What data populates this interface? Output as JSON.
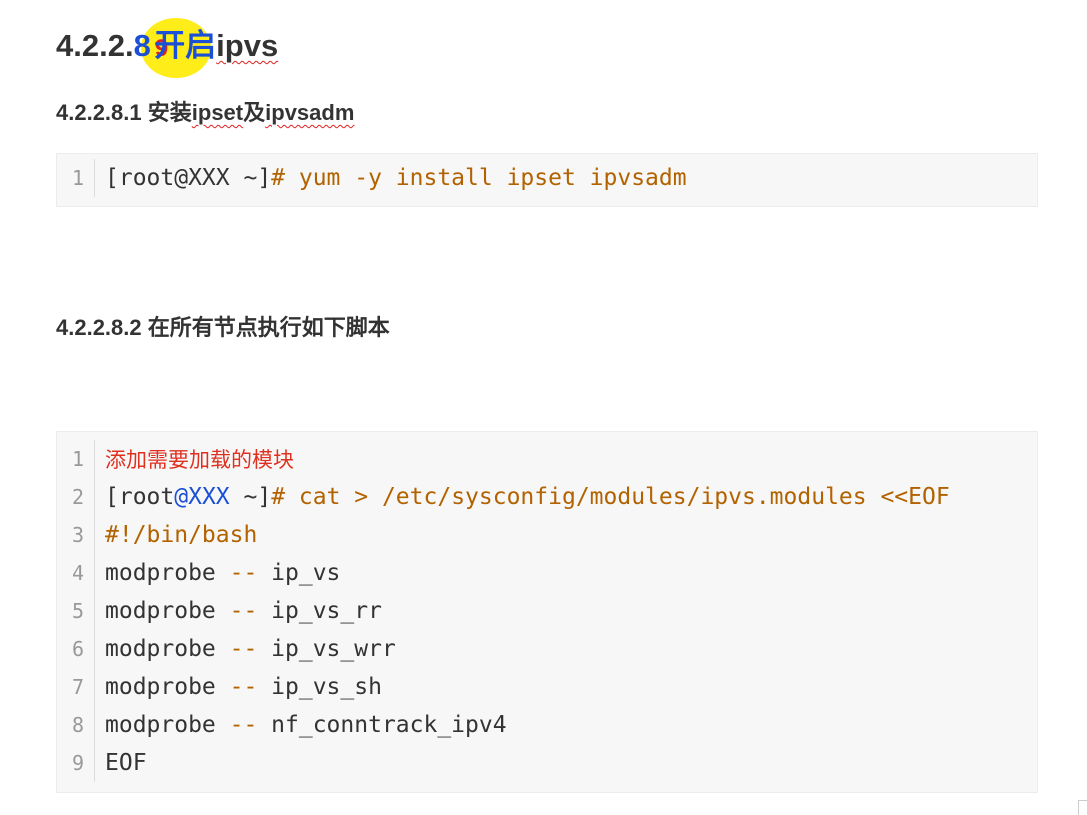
{
  "heading": {
    "prefix": "4.2.2.",
    "number": "8",
    "typo_char": "9",
    "title_cn": "开启",
    "title_en": "ipvs"
  },
  "section1": {
    "title_num": "4.2.2.8.1 ",
    "title_cn1": "安装",
    "title_en1": "ipset",
    "title_cn2": "及",
    "title_en2": "ipvsadm"
  },
  "code1": {
    "lines": [
      {
        "no": "1",
        "prompt": "[root@XXX ~]",
        "cmd": "# yum -y install ipset ipvsadm"
      }
    ]
  },
  "section2": {
    "title": "4.2.2.8.2 在所有节点执行如下脚本"
  },
  "code2": {
    "comment": "添加需要加载的模块",
    "prompt_a": "[root",
    "prompt_at": "@XXX",
    "prompt_b": " ~]",
    "cmd": "# cat > /etc/sysconfig/modules/ipvs.modules <<EOF",
    "shebang": "#!/bin/bash",
    "modprobe": "modprobe",
    "dashes": " -- ",
    "modules": [
      "ip_vs",
      "ip_vs_rr",
      "ip_vs_wrr",
      "ip_vs_sh",
      "nf_conntrack_ipv4"
    ],
    "eof": "EOF",
    "line_numbers": [
      "1",
      "2",
      "3",
      "4",
      "5",
      "6",
      "7",
      "8",
      "9"
    ]
  }
}
